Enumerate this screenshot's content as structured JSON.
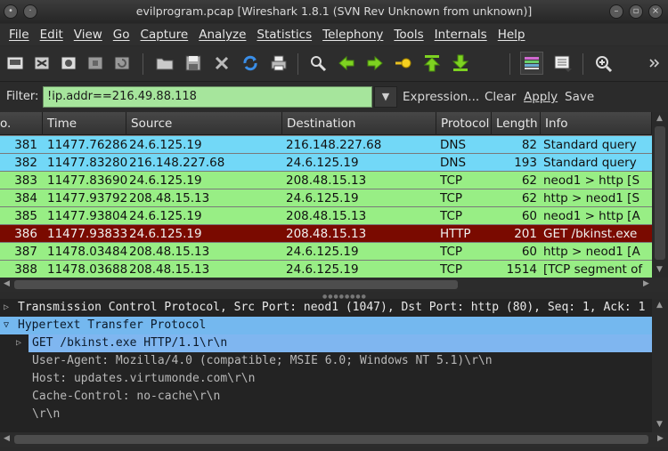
{
  "window": {
    "title": "evilprogram.pcap   [Wireshark 1.8.1  (SVN Rev Unknown from unknown)]"
  },
  "menu": [
    "File",
    "Edit",
    "View",
    "Go",
    "Capture",
    "Analyze",
    "Statistics",
    "Telephony",
    "Tools",
    "Internals",
    "Help"
  ],
  "filter": {
    "label": "Filter:",
    "value": "!ip.addr==216.49.88.118",
    "expression_label": "Expression...",
    "clear_label": "Clear",
    "apply_label": "Apply",
    "save_label": "Save"
  },
  "packet_list": {
    "columns": [
      "o.",
      "Time",
      "Source",
      "Destination",
      "Protocol",
      "Length",
      "Info"
    ],
    "rows": [
      {
        "no": "381",
        "time": "11477.76286",
        "source": "24.6.125.19",
        "destination": "216.148.227.68",
        "protocol": "DNS",
        "length": "82",
        "info": "Standard query",
        "bg": "#72d8f7",
        "fg": "#111111"
      },
      {
        "no": "382",
        "time": "11477.83280",
        "source": "216.148.227.68",
        "destination": "24.6.125.19",
        "protocol": "DNS",
        "length": "193",
        "info": "Standard query",
        "bg": "#72d8f7",
        "fg": "#111111"
      },
      {
        "no": "383",
        "time": "11477.83690",
        "source": "24.6.125.19",
        "destination": "208.48.15.13",
        "protocol": "TCP",
        "length": "62",
        "info": "neod1 > http [S",
        "bg": "#98ee85",
        "fg": "#111111"
      },
      {
        "no": "384",
        "time": "11477.93792",
        "source": "208.48.15.13",
        "destination": "24.6.125.19",
        "protocol": "TCP",
        "length": "62",
        "info": "http > neod1 [S",
        "bg": "#98ee85",
        "fg": "#111111"
      },
      {
        "no": "385",
        "time": "11477.93804",
        "source": "24.6.125.19",
        "destination": "208.48.15.13",
        "protocol": "TCP",
        "length": "60",
        "info": "neod1 > http [A",
        "bg": "#98ee85",
        "fg": "#111111"
      },
      {
        "no": "386",
        "time": "11477.93833",
        "source": "24.6.125.19",
        "destination": "208.48.15.13",
        "protocol": "HTTP",
        "length": "201",
        "info": "GET /bkinst.exe",
        "bg": "#7a0a00",
        "fg": "#f0f0f0"
      },
      {
        "no": "387",
        "time": "11478.03484",
        "source": "208.48.15.13",
        "destination": "24.6.125.19",
        "protocol": "TCP",
        "length": "60",
        "info": "http > neod1 [A",
        "bg": "#98ee85",
        "fg": "#111111"
      },
      {
        "no": "388",
        "time": "11478.03688",
        "source": "208.48.15.13",
        "destination": "24.6.125.19",
        "protocol": "TCP",
        "length": "1514",
        "info": "[TCP segment of",
        "bg": "#98ee85",
        "fg": "#111111"
      }
    ]
  },
  "details": {
    "lines": [
      {
        "text": "Transmission Control Protocol, Src Port: neod1 (1047), Dst Port: http (80), Seq: 1, Ack: 1",
        "expander": "collapsed",
        "style": "normal"
      },
      {
        "text": "Hypertext Transfer Protocol",
        "expander": "expanded",
        "style": "header"
      },
      {
        "text": "GET /bkinst.exe HTTP/1.1\\r\\n",
        "expander": "collapsed",
        "style": "selected"
      },
      {
        "text": "User-Agent: Mozilla/4.0 (compatible; MSIE 6.0; Windows NT 5.1)\\r\\n",
        "expander": "none",
        "style": "dim"
      },
      {
        "text": "Host: updates.virtumonde.com\\r\\n",
        "expander": "none",
        "style": "dim"
      },
      {
        "text": "Cache-Control: no-cache\\r\\n",
        "expander": "none",
        "style": "dim"
      },
      {
        "text": "\\r\\n",
        "expander": "none",
        "style": "dim"
      }
    ]
  },
  "colors": {
    "dns_row": "#72d8f7",
    "tcp_row": "#98ee85",
    "http_row": "#7a0a00",
    "filter_valid": "#a6e59c",
    "detail_header": "#74b8ef",
    "detail_selected": "#7fb6f0"
  }
}
